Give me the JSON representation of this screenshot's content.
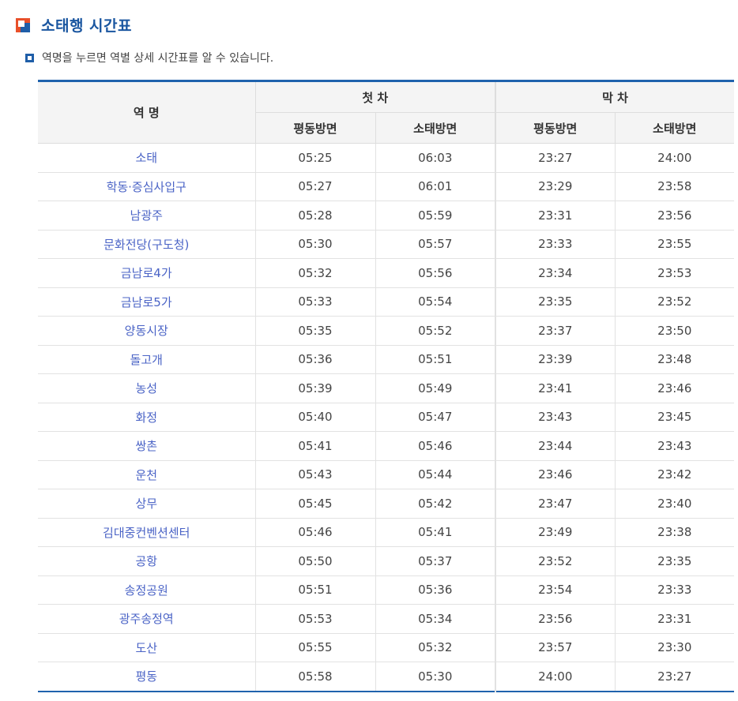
{
  "page": {
    "title": "소태행 시간표",
    "notice": "역명을 누르면 역별 상세 시간표를 알 수 있습니다."
  },
  "table": {
    "station_header": "역 명",
    "first_train_header": "첫 차",
    "last_train_header": "막 차",
    "dir_pyeongdong": "평동방면",
    "dir_sotae": "소태방면",
    "rows": [
      {
        "station": "소태",
        "first_pyeongdong": "05:25",
        "first_sotae": "06:03",
        "last_pyeongdong": "23:27",
        "last_sotae": "24:00"
      },
      {
        "station": "학동·증심사입구",
        "first_pyeongdong": "05:27",
        "first_sotae": "06:01",
        "last_pyeongdong": "23:29",
        "last_sotae": "23:58"
      },
      {
        "station": "남광주",
        "first_pyeongdong": "05:28",
        "first_sotae": "05:59",
        "last_pyeongdong": "23:31",
        "last_sotae": "23:56"
      },
      {
        "station": "문화전당(구도청)",
        "first_pyeongdong": "05:30",
        "first_sotae": "05:57",
        "last_pyeongdong": "23:33",
        "last_sotae": "23:55"
      },
      {
        "station": "금남로4가",
        "first_pyeongdong": "05:32",
        "first_sotae": "05:56",
        "last_pyeongdong": "23:34",
        "last_sotae": "23:53"
      },
      {
        "station": "금남로5가",
        "first_pyeongdong": "05:33",
        "first_sotae": "05:54",
        "last_pyeongdong": "23:35",
        "last_sotae": "23:52"
      },
      {
        "station": "양동시장",
        "first_pyeongdong": "05:35",
        "first_sotae": "05:52",
        "last_pyeongdong": "23:37",
        "last_sotae": "23:50"
      },
      {
        "station": "돌고개",
        "first_pyeongdong": "05:36",
        "first_sotae": "05:51",
        "last_pyeongdong": "23:39",
        "last_sotae": "23:48"
      },
      {
        "station": "농성",
        "first_pyeongdong": "05:39",
        "first_sotae": "05:49",
        "last_pyeongdong": "23:41",
        "last_sotae": "23:46"
      },
      {
        "station": "화정",
        "first_pyeongdong": "05:40",
        "first_sotae": "05:47",
        "last_pyeongdong": "23:43",
        "last_sotae": "23:45"
      },
      {
        "station": "쌍촌",
        "first_pyeongdong": "05:41",
        "first_sotae": "05:46",
        "last_pyeongdong": "23:44",
        "last_sotae": "23:43"
      },
      {
        "station": "운천",
        "first_pyeongdong": "05:43",
        "first_sotae": "05:44",
        "last_pyeongdong": "23:46",
        "last_sotae": "23:42"
      },
      {
        "station": "상무",
        "first_pyeongdong": "05:45",
        "first_sotae": "05:42",
        "last_pyeongdong": "23:47",
        "last_sotae": "23:40"
      },
      {
        "station": "김대중컨벤션센터",
        "first_pyeongdong": "05:46",
        "first_sotae": "05:41",
        "last_pyeongdong": "23:49",
        "last_sotae": "23:38"
      },
      {
        "station": "공항",
        "first_pyeongdong": "05:50",
        "first_sotae": "05:37",
        "last_pyeongdong": "23:52",
        "last_sotae": "23:35"
      },
      {
        "station": "송정공원",
        "first_pyeongdong": "05:51",
        "first_sotae": "05:36",
        "last_pyeongdong": "23:54",
        "last_sotae": "23:33"
      },
      {
        "station": "광주송정역",
        "first_pyeongdong": "05:53",
        "first_sotae": "05:34",
        "last_pyeongdong": "23:56",
        "last_sotae": "23:31"
      },
      {
        "station": "도산",
        "first_pyeongdong": "05:55",
        "first_sotae": "05:32",
        "last_pyeongdong": "23:57",
        "last_sotae": "23:30"
      },
      {
        "station": "평동",
        "first_pyeongdong": "05:58",
        "first_sotae": "05:30",
        "last_pyeongdong": "24:00",
        "last_sotae": "23:27"
      }
    ]
  },
  "colors": {
    "title": "#1a56a0",
    "accent_blue": "#1f62ad",
    "accent_orange": "#e8502a",
    "station_link": "#4a63c6",
    "header_bg": "#f4f4f4"
  }
}
